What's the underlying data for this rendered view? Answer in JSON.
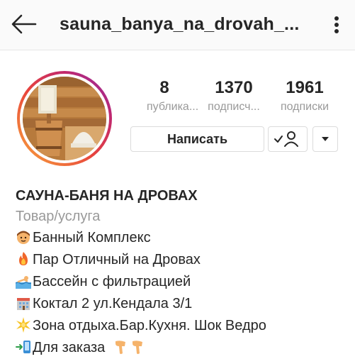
{
  "header": {
    "back_icon": "arrow-left-icon",
    "username": "sauna_banya_na_drovah_...",
    "more_icon": "vertical-ellipsis-icon"
  },
  "profile": {
    "avatar": "sauna-wooden-bucket-photo",
    "ring_colors": [
      "#f9a93b",
      "#e8443c",
      "#c1286e",
      "#8c2fa8"
    ]
  },
  "stats": [
    {
      "value": "8",
      "label": "публика..."
    },
    {
      "value": "1370",
      "label": "подписч..."
    },
    {
      "value": "1961",
      "label": "подписки"
    }
  ],
  "actions": {
    "message_label": "Написать",
    "follow_icon": "person-check-icon",
    "dropdown_icon": "triangle-down-icon"
  },
  "bio": {
    "name": "САУНА-БАНЯ НА ДРОВАХ",
    "category": "Товар/услуга",
    "lines": [
      {
        "emoji": "person-face-emoji",
        "text": "Банный Комплекс"
      },
      {
        "emoji": "fire-emoji",
        "text": "Пар Отличный на Дровах"
      },
      {
        "emoji": "swimmer-emoji",
        "text": "Бассейн с фильтрацией"
      },
      {
        "emoji": "building-emoji",
        "text": "Коктал 2 ул.Кендала 3/1"
      },
      {
        "emoji": "sparkle-emoji",
        "text": "Зона отдыха.Бар.Кухня. Шок Ведро"
      },
      {
        "emoji": "phone-arrow-emoji",
        "text": "Для заказа"
      }
    ],
    "trailing_emoji": "pointing-down-hands-emoji"
  }
}
